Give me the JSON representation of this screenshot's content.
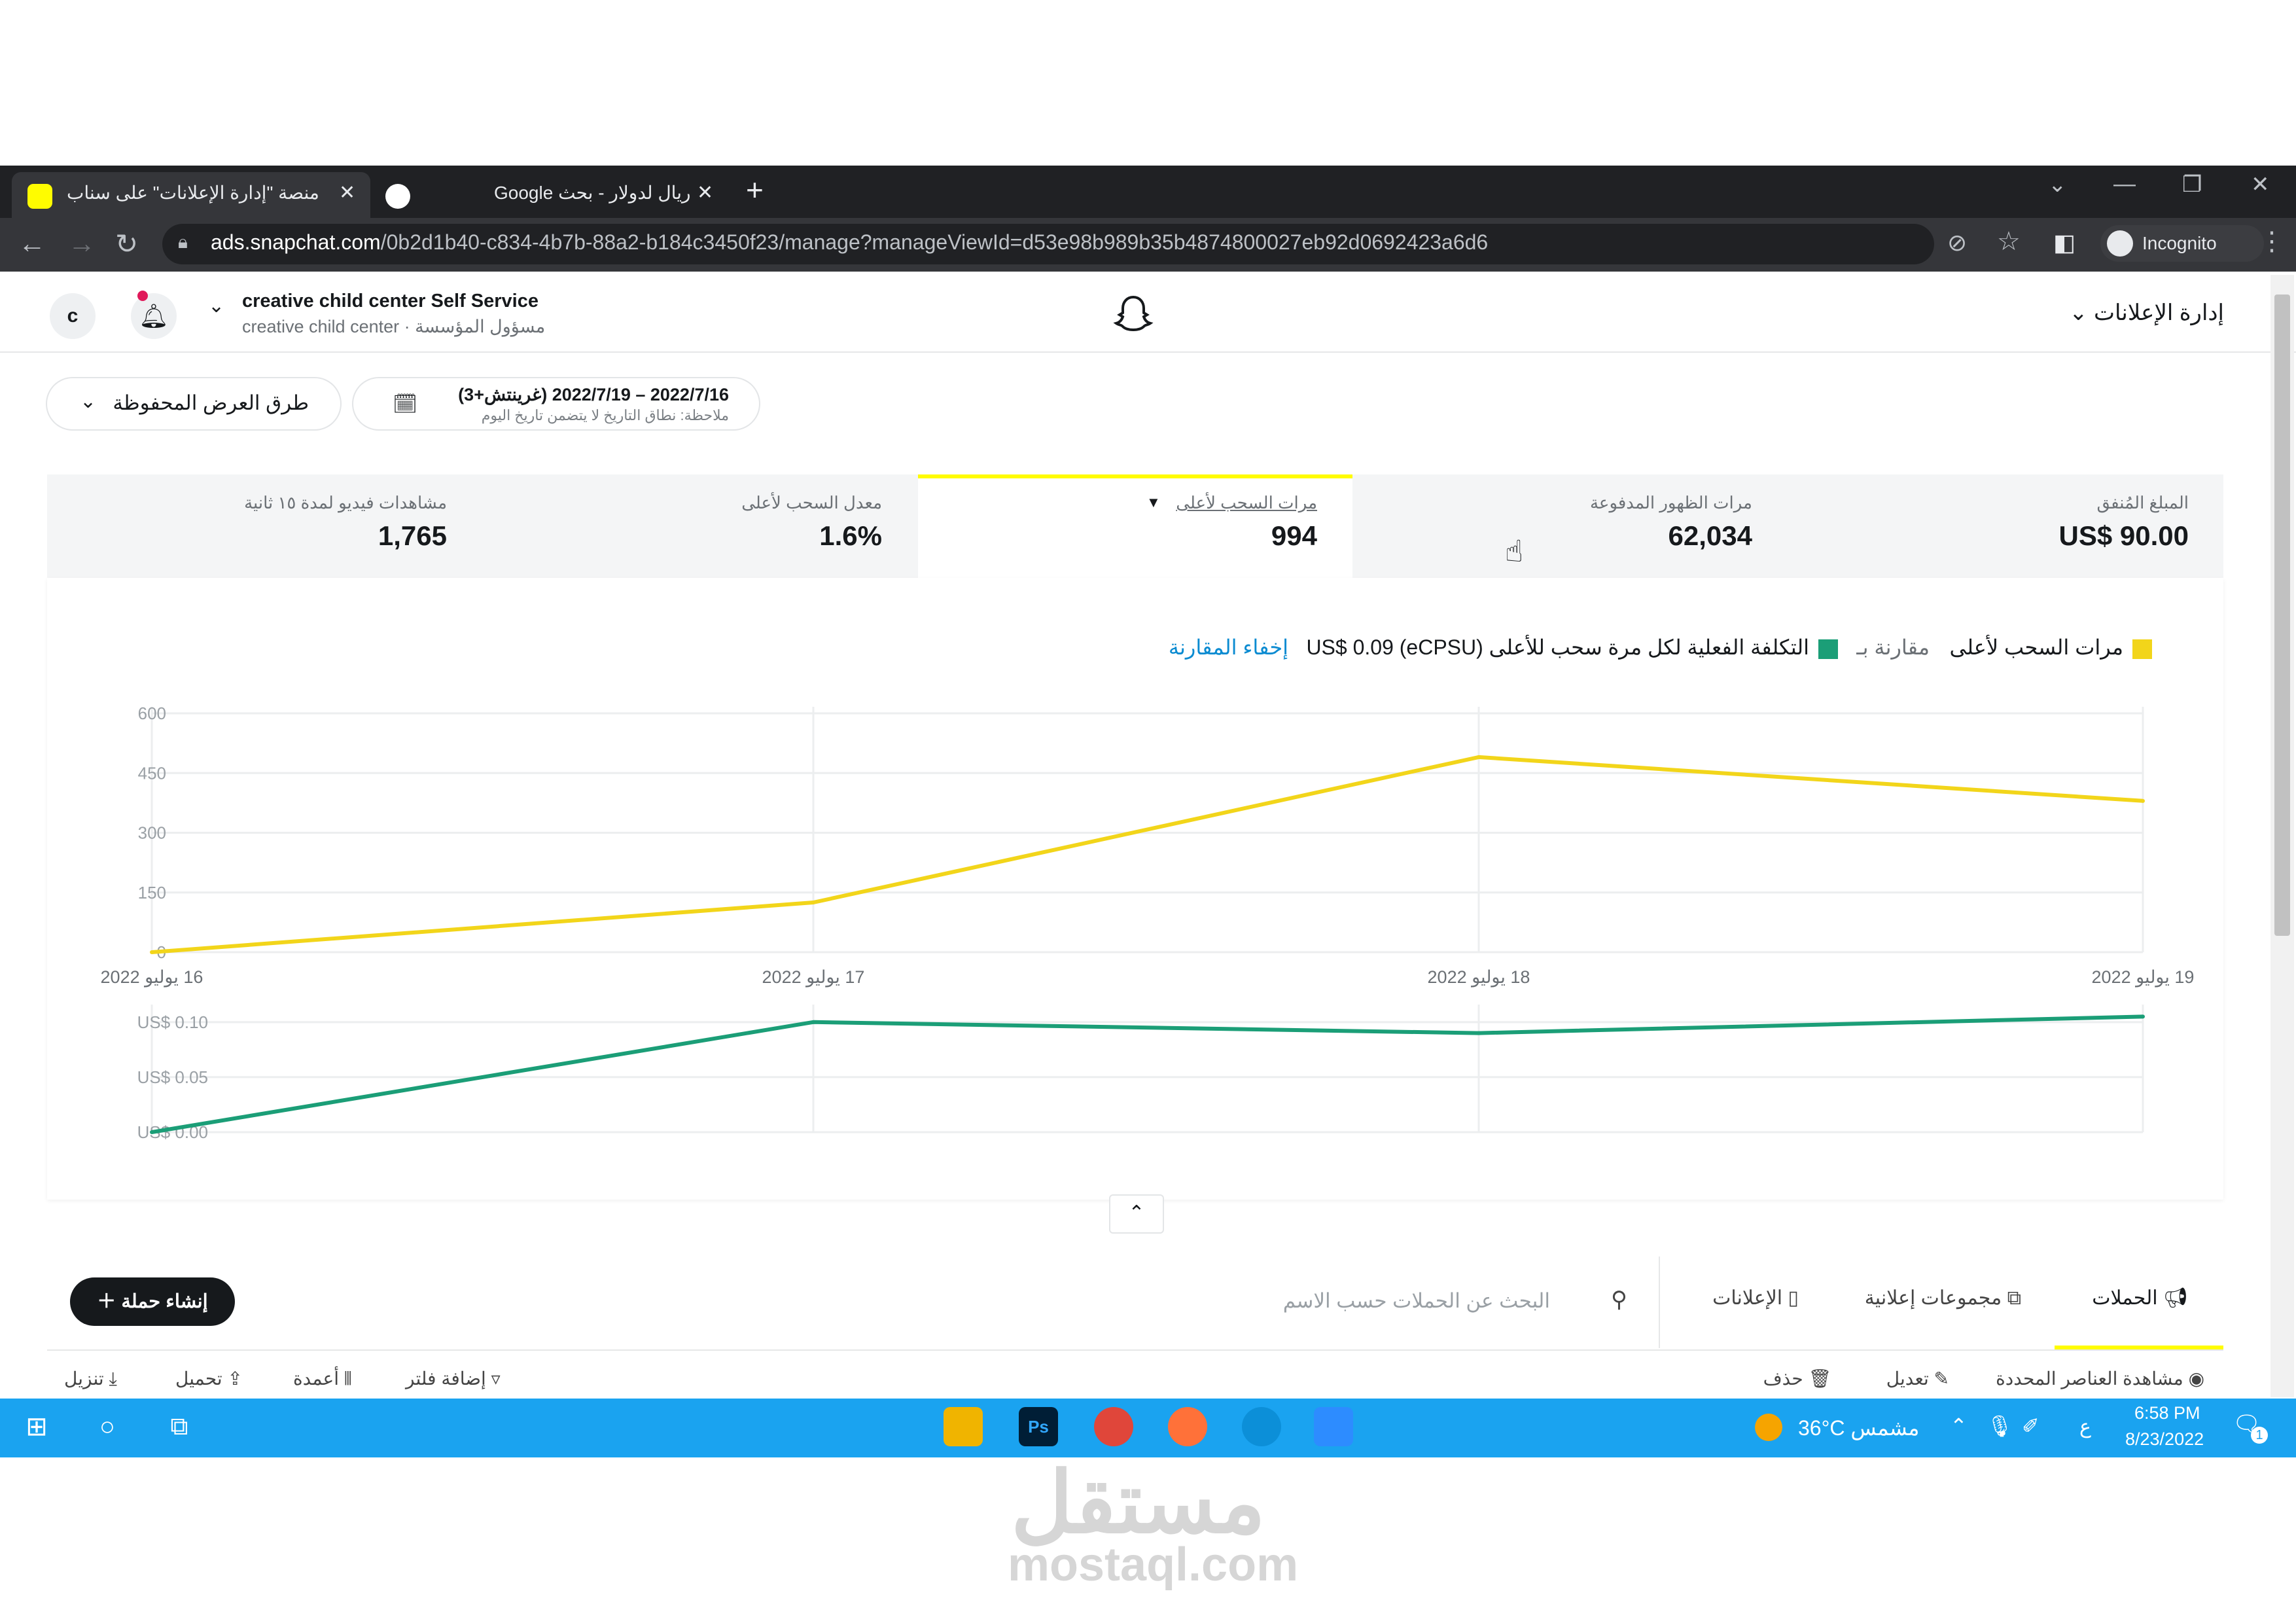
{
  "browser": {
    "active_tab_title": "منصة \"إدارة الإعلانات\" على سناب",
    "inactive_tab_title": "ريال لدولار - بحث Google",
    "url_domain": "ads.snapchat.com",
    "url_path": "/0b2d1b40-c834-4b7b-88a2-b184c3450f23/manage?manageViewId=d53e98b989b35b4874800027eb92d0692423a6d6",
    "profile_label": "Incognito"
  },
  "header": {
    "avatar_letter": "c",
    "org_name": "creative child center Self Service",
    "org_sub": "مسؤول المؤسسة · creative child center",
    "ads_manager_label": "إدارة الإعلانات"
  },
  "filters": {
    "saved_views_label": "طرق العرض المحفوظة",
    "date_range": "2022/7/16 – 2022/7/19 (غرينتش+3)",
    "date_note": "ملاحظة: نطاق التاريخ لا يتضمن تاريخ اليوم"
  },
  "metrics": [
    {
      "label": "المبلغ المُنفق",
      "value": "US$ 90.00"
    },
    {
      "label": "مرات الظهور المدفوعة",
      "value": "62,034"
    },
    {
      "label": "مرات السحب لأعلى",
      "value": "994"
    },
    {
      "label": "معدل السحب لأعلى",
      "value": "1.6%"
    },
    {
      "label": "مشاهدات فيديو لمدة ١٥ ثانية",
      "value": "1,765"
    }
  ],
  "legend": {
    "primary": "مرات السحب لأعلى",
    "compare_with": "مقارنة بـ",
    "secondary": "التكلفة الفعلية لكل مرة سحب للأعلى (eCPSU) US$ 0.09",
    "hide_compare": "إخفاء المقارنة"
  },
  "colors": {
    "primary_series": "#f2d51a",
    "secondary_series": "#1b9e77",
    "accent": "#fffc00",
    "link": "#0a8bd1",
    "taskbar": "#1aa3f0"
  },
  "chart_data": [
    {
      "type": "line",
      "x": [
        "16 يوليو 2022",
        "17 يوليو 2022",
        "18 يوليو 2022",
        "19 يوليو 2022"
      ],
      "series": [
        {
          "name": "مرات السحب لأعلى",
          "values": [
            0,
            125,
            490,
            380
          ]
        }
      ],
      "yticks": [
        "0",
        "150",
        "300",
        "450",
        "600"
      ],
      "ylim": [
        0,
        600
      ],
      "grid": true
    },
    {
      "type": "line",
      "x": [
        "16 يوليو 2022",
        "17 يوليو 2022",
        "18 يوليو 2022",
        "19 يوليو 2022"
      ],
      "series": [
        {
          "name": "التكلفة الفعلية لكل مرة سحب للأعلى (eCPSU)",
          "values": [
            0.0,
            0.1,
            0.09,
            0.105
          ]
        }
      ],
      "yticks": [
        "US$ 0.00",
        "US$ 0.05",
        "US$ 0.10"
      ],
      "ylim": [
        0,
        0.11
      ],
      "grid": true
    }
  ],
  "toolbar": {
    "tabs": [
      "الحملات",
      "مجموعات إعلانية",
      "الإعلانات"
    ],
    "search_placeholder": "البحث عن الحملات حسب الاسم",
    "create_label": "إنشاء حملة",
    "actions_right": [
      "مشاهدة العناصر المحددة",
      "تعديل",
      "حذف"
    ],
    "actions_left": [
      "إضافة فلتر",
      "أعمدة",
      "تحميل",
      "تنزيل"
    ]
  },
  "taskbar": {
    "weather": "36°C  مشمس",
    "lang": "ع",
    "time": "6:58 PM",
    "date": "8/23/2022",
    "notif_count": "1"
  },
  "watermark": {
    "arabic": "مستقل",
    "latin": "mostaql.com"
  }
}
